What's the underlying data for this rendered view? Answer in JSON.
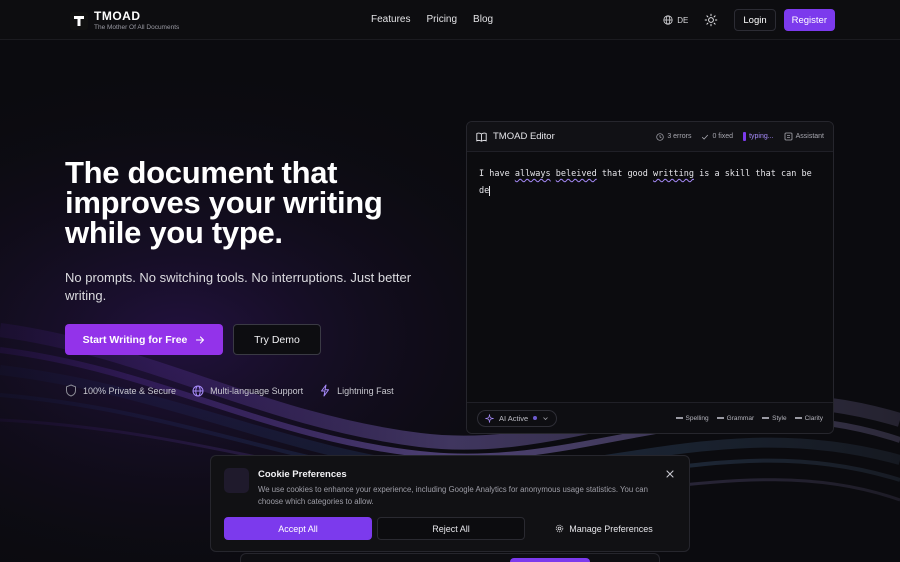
{
  "brand": {
    "name": "TMOAD",
    "tagline": "The Mother Of All Documents",
    "accent": "#7c3aed"
  },
  "nav": {
    "links": [
      "Features",
      "Pricing",
      "Blog"
    ],
    "language": "DE",
    "theme_icon": "sun-icon",
    "login_label": "Login",
    "register_label": "Register"
  },
  "hero": {
    "title": "The document that improves your writing while you type.",
    "subtitle": "No prompts. No switching tools. No interruptions. Just better writing.",
    "primary_cta": "Start Writing for Free",
    "secondary_cta": "Try Demo",
    "features": [
      {
        "icon": "shield-icon",
        "label": "100% Private & Secure"
      },
      {
        "icon": "globe-icon",
        "label": "Multi-language Support"
      },
      {
        "icon": "lightning-icon",
        "label": "Lightning Fast"
      }
    ]
  },
  "editor": {
    "title": "TMOAD Editor",
    "errors": "3 errors",
    "fixed": "0 fixed",
    "typing": "typing...",
    "assistant": "Assistant",
    "text_segments": [
      {
        "t": "I have ",
        "err": false
      },
      {
        "t": "allways",
        "err": true
      },
      {
        "t": " ",
        "err": false
      },
      {
        "t": "beleived",
        "err": true
      },
      {
        "t": " that good ",
        "err": false
      },
      {
        "t": "writting",
        "err": true
      },
      {
        "t": " is a skill that can be de",
        "err": false
      }
    ],
    "ai_status": "AI Active",
    "legend": [
      "Spelling",
      "Grammar",
      "Style",
      "Clarity"
    ]
  },
  "cookie": {
    "title": "Cookie Preferences",
    "text": "We use cookies to enhance your experience, including Google Analytics for anonymous usage statistics. You can choose which categories to allow.",
    "accept_label": "Accept All",
    "reject_label": "Reject All",
    "manage_label": "Manage Preferences"
  }
}
